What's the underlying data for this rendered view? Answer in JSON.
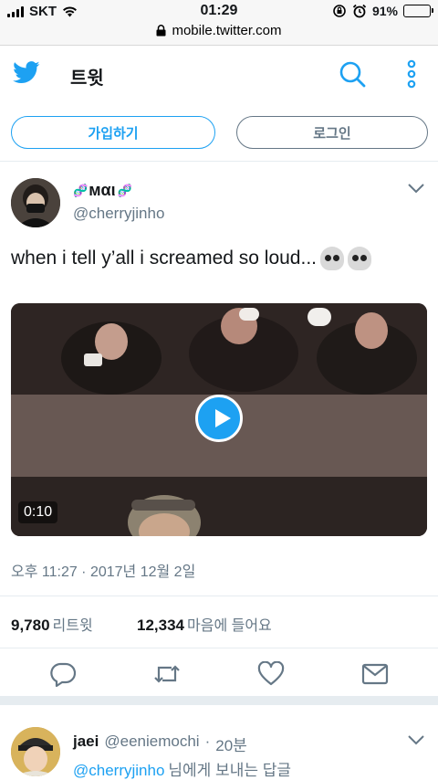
{
  "status_bar": {
    "carrier": "SKT",
    "time": "01:29",
    "battery": "91%",
    "battery_level": 0.91,
    "url": "mobile.twitter.com"
  },
  "header": {
    "title": "트윗",
    "signup_label": "가입하기",
    "login_label": "로그인"
  },
  "tweet": {
    "display_name": "ᴍαι",
    "name_decor": "🧬",
    "handle": "@cherryjinho",
    "text": "when i tell y’all i screamed so loud...",
    "video_duration": "0:10",
    "timestamp": "오후 11:27 · 2017년 12월 2일",
    "retweet_count": "9,780",
    "retweet_label": "리트윗",
    "like_count": "12,334",
    "like_label": "마음에 들어요"
  },
  "reply": {
    "display_name": "jaei",
    "handle": "@eeniemochi",
    "time": "20분",
    "to_handle": "@cherryjinho",
    "to_suffix": "님에게 보내는 답글"
  },
  "colors": {
    "accent": "#1da1f2",
    "muted": "#657786",
    "divider": "#e6ecf0",
    "battery": "#f3c623"
  }
}
